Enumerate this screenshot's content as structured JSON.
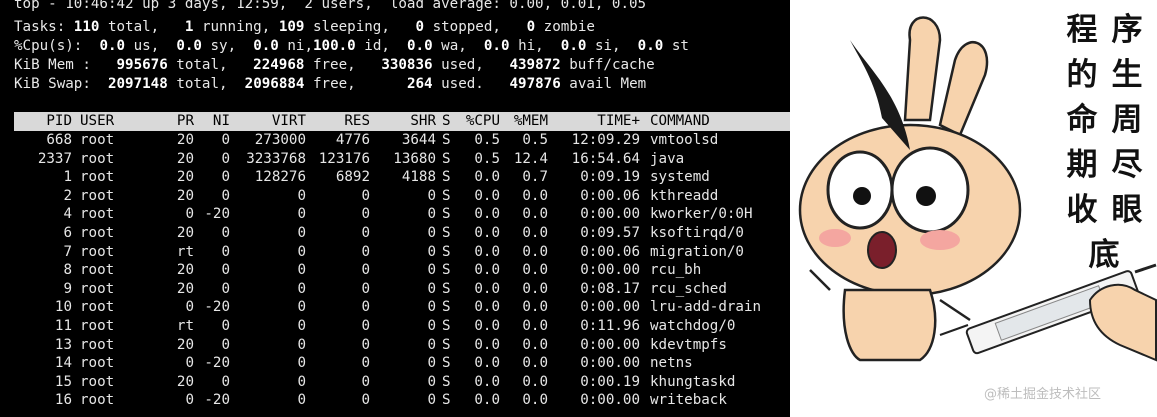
{
  "terminal": {
    "summary": {
      "l1": "top - 10:46:42 up 3 days, 12:59,  2 users,  load average: 0.00, 0.01, 0.05",
      "tasks": {
        "label": "Tasks:",
        "total": "110",
        "t_total": "total,",
        "running": "1",
        "t_running": "running,",
        "sleeping": "109",
        "t_sleeping": "sleeping,",
        "stopped": "0",
        "t_stopped": "stopped,",
        "zombie": "0",
        "t_zombie": "zombie"
      },
      "cpu": {
        "label": "%Cpu(s):",
        "us": "0.0",
        "t_us": "us,",
        "sy": "0.0",
        "t_sy": "sy,",
        "ni": "0.0",
        "t_ni": "ni,",
        "id": "100.0",
        "t_id": "id,",
        "wa": "0.0",
        "t_wa": "wa,",
        "hi": "0.0",
        "t_hi": "hi,",
        "si": "0.0",
        "t_si": "si,",
        "st": "0.0",
        "t_st": "st"
      },
      "mem": {
        "label": "KiB Mem :",
        "total": "995676",
        "t_total": "total,",
        "free": "224968",
        "t_free": "free,",
        "used": "330836",
        "t_used": "used,",
        "buff": "439872",
        "t_buff": "buff/cache"
      },
      "swap": {
        "label": "KiB Swap:",
        "total": "2097148",
        "t_total": "total,",
        "free": "2096884",
        "t_free": "free,",
        "used": "264",
        "t_used": "used.",
        "avail": "497876",
        "t_avail": "avail Mem"
      }
    },
    "columns": [
      "PID",
      "USER",
      "PR",
      "NI",
      "VIRT",
      "RES",
      "SHR",
      "S",
      "%CPU",
      "%MEM",
      "TIME+",
      "COMMAND"
    ],
    "rows": [
      [
        "668",
        "root",
        "20",
        "0",
        "273000",
        "4776",
        "3644",
        "S",
        "0.5",
        "0.5",
        "12:09.29",
        "vmtoolsd"
      ],
      [
        "2337",
        "root",
        "20",
        "0",
        "3233768",
        "123176",
        "13680",
        "S",
        "0.5",
        "12.4",
        "16:54.64",
        "java"
      ],
      [
        "1",
        "root",
        "20",
        "0",
        "128276",
        "6892",
        "4188",
        "S",
        "0.0",
        "0.7",
        "0:09.19",
        "systemd"
      ],
      [
        "2",
        "root",
        "20",
        "0",
        "0",
        "0",
        "0",
        "S",
        "0.0",
        "0.0",
        "0:00.06",
        "kthreadd"
      ],
      [
        "4",
        "root",
        "0",
        "-20",
        "0",
        "0",
        "0",
        "S",
        "0.0",
        "0.0",
        "0:00.00",
        "kworker/0:0H"
      ],
      [
        "6",
        "root",
        "20",
        "0",
        "0",
        "0",
        "0",
        "S",
        "0.0",
        "0.0",
        "0:09.57",
        "ksoftirqd/0"
      ],
      [
        "7",
        "root",
        "rt",
        "0",
        "0",
        "0",
        "0",
        "S",
        "0.0",
        "0.0",
        "0:00.06",
        "migration/0"
      ],
      [
        "8",
        "root",
        "20",
        "0",
        "0",
        "0",
        "0",
        "S",
        "0.0",
        "0.0",
        "0:00.00",
        "rcu_bh"
      ],
      [
        "9",
        "root",
        "20",
        "0",
        "0",
        "0",
        "0",
        "S",
        "0.0",
        "0.0",
        "0:08.17",
        "rcu_sched"
      ],
      [
        "10",
        "root",
        "0",
        "-20",
        "0",
        "0",
        "0",
        "S",
        "0.0",
        "0.0",
        "0:00.00",
        "lru-add-drain"
      ],
      [
        "11",
        "root",
        "rt",
        "0",
        "0",
        "0",
        "0",
        "S",
        "0.0",
        "0.0",
        "0:11.96",
        "watchdog/0"
      ],
      [
        "13",
        "root",
        "20",
        "0",
        "0",
        "0",
        "0",
        "S",
        "0.0",
        "0.0",
        "0:00.00",
        "kdevtmpfs"
      ],
      [
        "14",
        "root",
        "0",
        "-20",
        "0",
        "0",
        "0",
        "S",
        "0.0",
        "0.0",
        "0:00.00",
        "netns"
      ],
      [
        "15",
        "root",
        "20",
        "0",
        "0",
        "0",
        "0",
        "S",
        "0.0",
        "0.0",
        "0:00.19",
        "khungtaskd"
      ],
      [
        "16",
        "root",
        "0",
        "-20",
        "0",
        "0",
        "0",
        "S",
        "0.0",
        "0.0",
        "0:00.00",
        "writeback"
      ]
    ]
  },
  "meme": {
    "caption_chars": [
      "程",
      "序",
      "的",
      "生",
      "命",
      "周",
      "期",
      "尽",
      "收",
      "眼",
      "底"
    ],
    "watermark": "@稀土掘金技术社区",
    "illustration": "cartoon-rabbit-syringe",
    "colors": {
      "skin": "#f7d3ad",
      "blush": "#f4a6a0",
      "outline": "#222222",
      "horn": "#1a1a1a"
    }
  },
  "colors": {
    "terminal_bg": "#000000",
    "header_bar": "#d9d9d9",
    "text": "#e6e6e6"
  }
}
